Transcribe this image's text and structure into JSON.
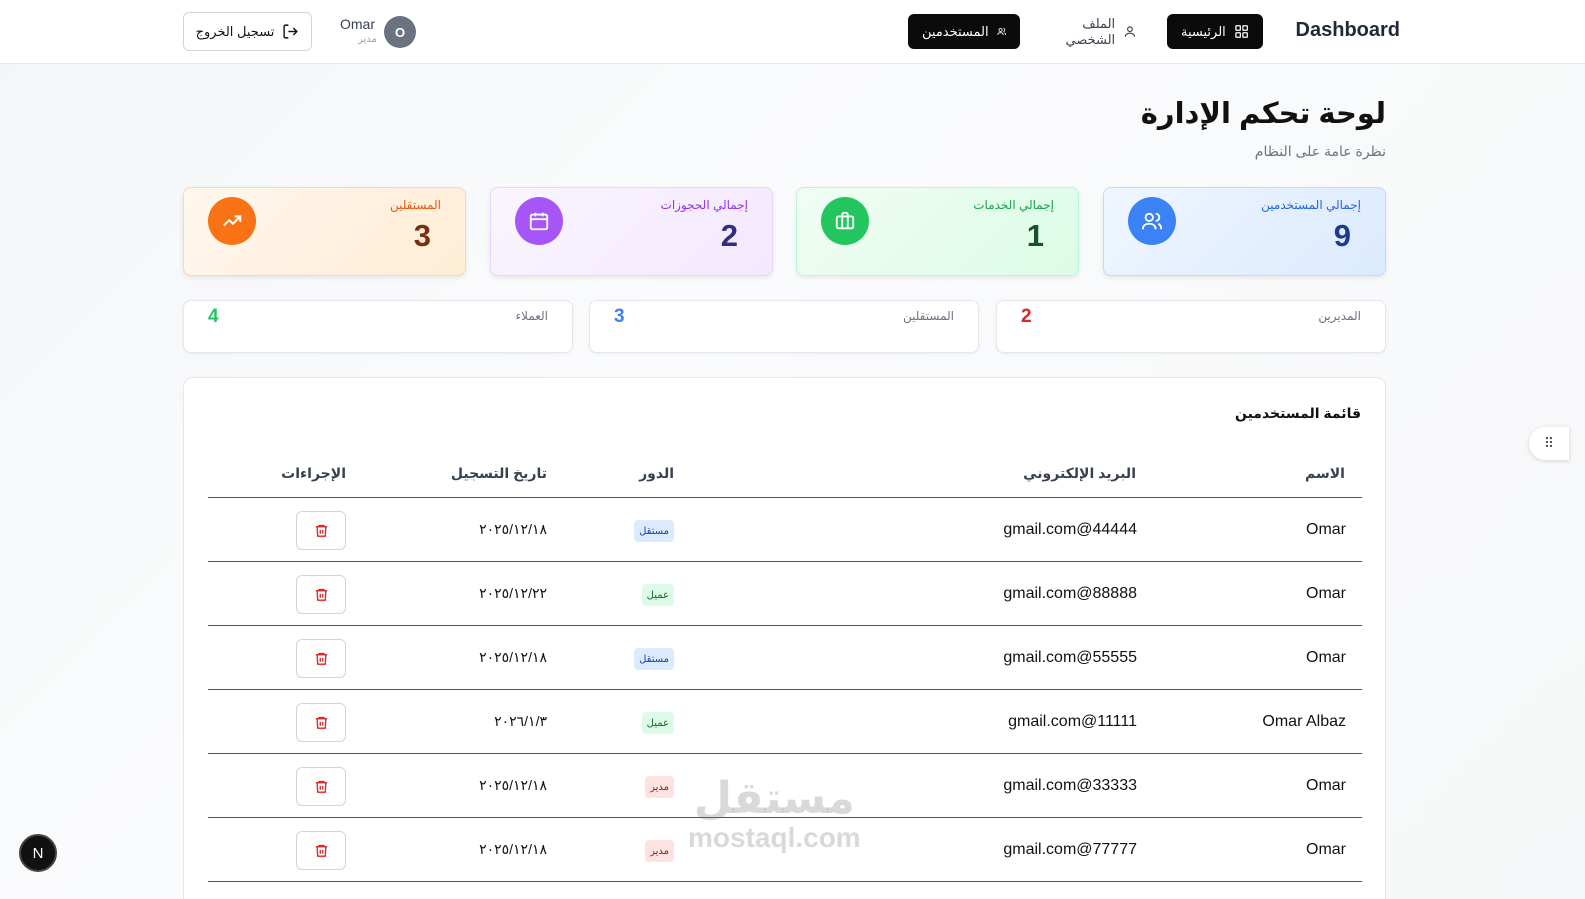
{
  "header": {
    "brand": "Dashboard",
    "nav": {
      "home": "الرئيسية",
      "profile": "الملف الشخصي",
      "users": "المستخدمين"
    },
    "user": {
      "initial": "O",
      "name": "Omar",
      "role": "مدير"
    },
    "logout": "تسجيل الخروج"
  },
  "page": {
    "title": "لوحة تحكم الإدارة",
    "subtitle": "نظرة عامة على النظام"
  },
  "stats": [
    {
      "label": "إجمالي المستخدمين",
      "value": "9",
      "icon": "users-icon",
      "color": "#3b82f6"
    },
    {
      "label": "إجمالي الخدمات",
      "value": "1",
      "icon": "briefcase-icon",
      "color": "#22c55e"
    },
    {
      "label": "إجمالي الحجوزات",
      "value": "2",
      "icon": "calendar-icon",
      "color": "#a855f7"
    },
    {
      "label": "المستقلين",
      "value": "3",
      "icon": "trending-up-icon",
      "color": "#f97316"
    }
  ],
  "roles": [
    {
      "label": "المديرين",
      "value": "2",
      "color": "#dc2626"
    },
    {
      "label": "المستقلين",
      "value": "3",
      "color": "#3b82f6"
    },
    {
      "label": "العملاء",
      "value": "4",
      "color": "#22c55e"
    }
  ],
  "table": {
    "title": "قائمة المستخدمين",
    "headers": {
      "name": "الاسم",
      "email": "البريد الإلكتروني",
      "role": "الدور",
      "date": "تاريخ التسجيل",
      "actions": "الإجراءات"
    },
    "rows": [
      {
        "name": "Omar",
        "email": "gmail.com@44444",
        "role": "مستقل",
        "date": "٢٠٢٥/١٢/١٨"
      },
      {
        "name": "Omar",
        "email": "gmail.com@88888",
        "role": "عميل",
        "date": "٢٠٢٥/١٢/٢٢"
      },
      {
        "name": "Omar",
        "email": "gmail.com@55555",
        "role": "مستقل",
        "date": "٢٠٢٥/١٢/١٨"
      },
      {
        "name": "Omar Albaz",
        "email": "gmail.com@11111",
        "role": "عميل",
        "date": "٢٠٢٦/١/٣"
      },
      {
        "name": "Omar",
        "email": "gmail.com@33333",
        "role": "مدير",
        "date": "٢٠٢٥/١٢/١٨"
      },
      {
        "name": "Omar",
        "email": "gmail.com@77777",
        "role": "مدير",
        "date": "٢٠٢٥/١٢/١٨"
      }
    ]
  },
  "badge_n": "N",
  "watermark": {
    "arabic": "مستقل",
    "latin": "mostaql.com"
  }
}
